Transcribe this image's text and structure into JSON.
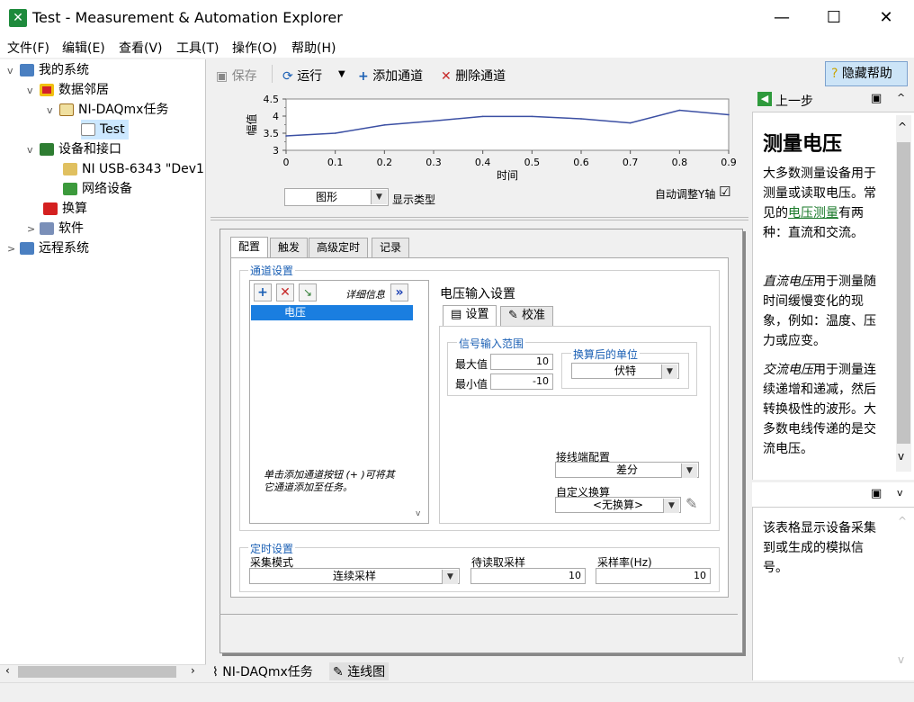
{
  "window": {
    "title": "Test - Measurement & Automation Explorer",
    "app_icon": "x-icon",
    "minimize": "—",
    "maximize": "☐",
    "close": "✕"
  },
  "menu": [
    "文件(F)",
    "编辑(E)",
    "查看(V)",
    "工具(T)",
    "操作(O)",
    "帮助(H)"
  ],
  "tree": {
    "my_system": "我的系统",
    "data_neighborhood": "数据邻居",
    "daqmx_tasks": "NI-DAQmx任务",
    "test": "Test",
    "devices": "设备和接口",
    "usb_device": "NI USB-6343 \"Dev1\"",
    "network_devices": "网络设备",
    "scales": "换算",
    "software": "软件",
    "remote_systems": "远程系统"
  },
  "toolbar": {
    "save": "保存",
    "run": "运行",
    "add_channel": "添加通道",
    "delete_channel": "删除通道",
    "hide_help": "隐藏帮助"
  },
  "chart_data": {
    "type": "line",
    "x": [
      0,
      0.1,
      0.2,
      0.3,
      0.4,
      0.5,
      0.6,
      0.7,
      0.8,
      0.9
    ],
    "series": [
      {
        "values": [
          3.42,
          3.5,
          3.74,
          3.86,
          3.99,
          3.99,
          3.92,
          3.8,
          4.17,
          4.04
        ]
      }
    ],
    "xlabel": "时间",
    "ylabel": "幅值",
    "xlim": [
      0,
      0.9
    ],
    "ylim": [
      3,
      4.5
    ],
    "xticks": [
      "0",
      "0.1",
      "0.2",
      "0.3",
      "0.4",
      "0.5",
      "0.6",
      "0.7",
      "0.8",
      "0.9"
    ],
    "yticks": [
      "3",
      "3.5",
      "4",
      "4.5"
    ],
    "grid": false,
    "line_color": "#3b4fa3"
  },
  "chart_controls": {
    "display_type_value": "图形",
    "display_type_label": "显示类型",
    "auto_scale_label": "自动调整Y轴",
    "auto_scale_check": "☑"
  },
  "config": {
    "tabs": [
      "配置",
      "触发",
      "高级定时",
      "记录"
    ],
    "channel_settings_label": "通道设置",
    "details_label": "详细信息",
    "channels": [
      "电压"
    ],
    "hint": "单击添加通道按钮 (+ )可将其它通道添加至任务。",
    "voltage_settings_title": "电压输入设置",
    "subtabs": [
      "设置",
      "校准"
    ],
    "signal_range_label": "信号输入范围",
    "max_label": "最大值",
    "max_value": "10",
    "min_label": "最小值",
    "min_value": "-10",
    "scaled_units_label": "换算后的单位",
    "scaled_units_value": "伏特",
    "terminal_config_label": "接线端配置",
    "terminal_config_value": "差分",
    "custom_scale_label": "自定义换算",
    "custom_scale_value": "<无换算>",
    "timing_label": "定时设置",
    "acq_mode_label": "采集模式",
    "acq_mode_value": "连续采样",
    "samples_to_read_label": "待读取采样",
    "samples_to_read_value": "10",
    "rate_label": "采样率(Hz)",
    "rate_value": "10"
  },
  "help": {
    "back": "上一步",
    "title": "测量电压",
    "p1_pre": "大多数测量设备用于测量或读取电压。常见的",
    "p1_link": "电压测量",
    "p1_post": "有两种：直流和交流。",
    "p2_em": "直流电压",
    "p2_rest": "用于测量随时间缓慢变化的现象，例如：温度、压力或应变。",
    "p3_em": "交流电压",
    "p3_rest": "用于测量连续递增和递减，然后转换极性的波形。大多数电线传递的是交流电压。",
    "bottom_text": "该表格显示设备采集到或生成的模拟信号。"
  },
  "bottom_tabs": [
    "NI-DAQmx任务",
    "连线图"
  ]
}
